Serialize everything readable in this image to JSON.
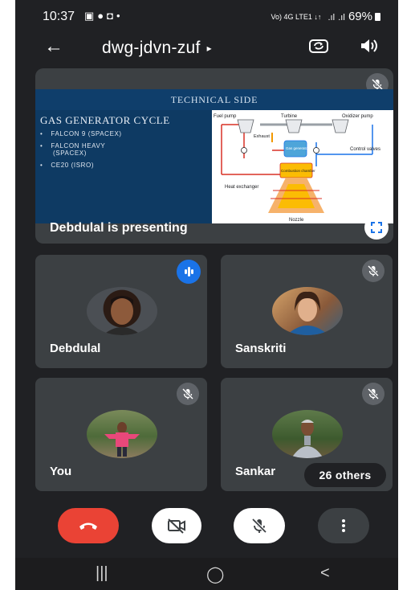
{
  "status_bar": {
    "time": "10:37",
    "notification_icons": [
      "gallery-icon",
      "chat-bubble-icon",
      "screen-record-icon",
      "dot-icon"
    ],
    "network_text": "Vo) 4G LTE1 ↓↑",
    "signal_icons": [
      "signal-icon",
      "signal-icon"
    ],
    "battery": "69%"
  },
  "top_bar": {
    "meeting_code": "dwg-jdvn-zuf",
    "meeting_caret": "▸"
  },
  "presentation": {
    "slide_title": "TECHNICAL SIDE",
    "slide_heading": "GAS GENERATOR CYCLE",
    "slide_bullets": [
      {
        "text": "FALCON 9 (SPACEX)"
      },
      {
        "text": "FALCON HEAVY"
      },
      {
        "text": "(SPACEX)"
      },
      {
        "text": "CE20 (ISRO)"
      }
    ],
    "diagram_labels": {
      "fuel_pump": "Fuel pump",
      "turbine": "Turbine",
      "oxidizer_pump": "Oxidizer pump",
      "exhaust": "Exhaust",
      "gas_generator": "Gas generator",
      "control_valves": "Control valves",
      "combustion_chamber": "Combustion chamber",
      "heat_exchanger": "Heat exchanger",
      "nozzle": "Nozzle"
    },
    "presenter_label": "Debdulal is presenting"
  },
  "participants": [
    {
      "name": "Debdulal",
      "status": "speaking"
    },
    {
      "name": "Sanskriti",
      "status": "muted"
    },
    {
      "name": "You",
      "status": "muted"
    },
    {
      "name": "Sankar",
      "status": "muted"
    }
  ],
  "others_label": "26 others",
  "colors": {
    "end_call": "#ea4335",
    "speaking_badge": "#1a73e8",
    "tile_background": "#3c4043",
    "app_background": "#202124"
  },
  "call_controls": [
    "end-call-icon",
    "camera-off-icon",
    "mic-off-icon",
    "more-options-icon"
  ],
  "nav_bar": {
    "recents": "|||",
    "home": "◯",
    "back": "<"
  }
}
